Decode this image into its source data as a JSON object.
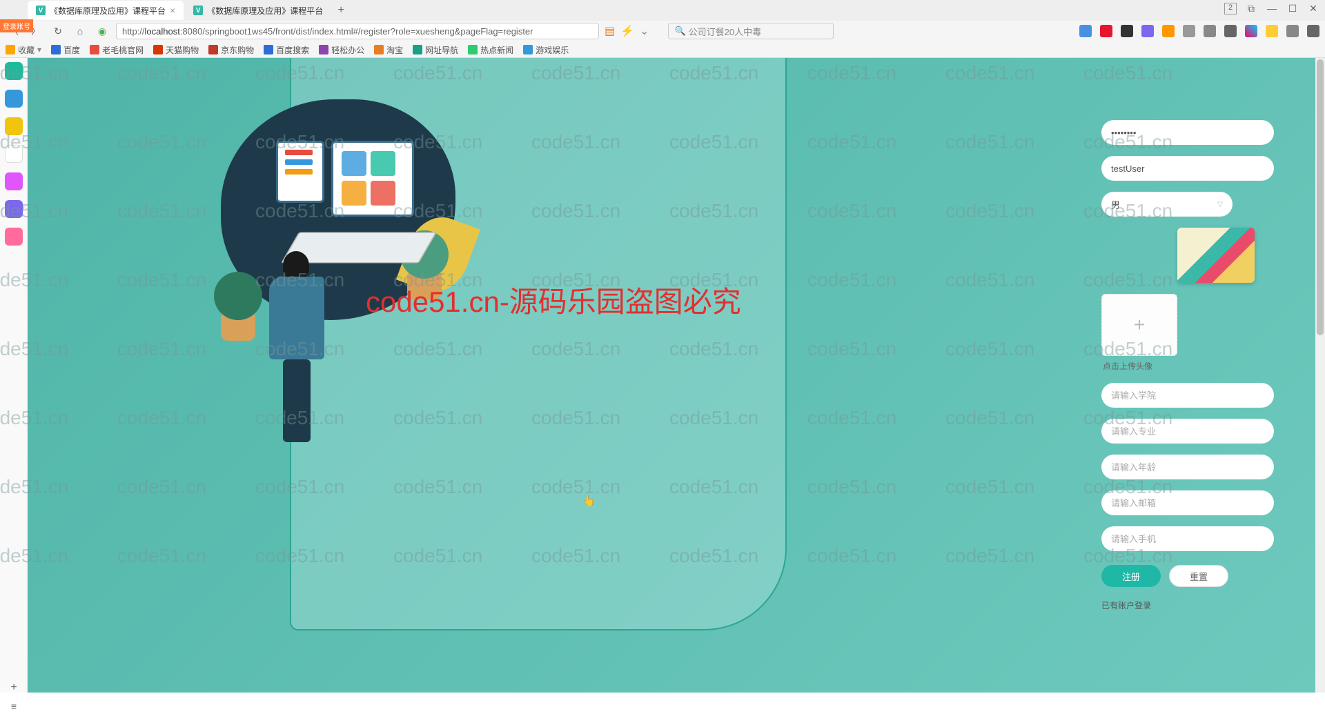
{
  "window": {
    "tabs": [
      {
        "title": "《数据库原理及应用》课程平台",
        "active": true
      },
      {
        "title": "《数据库原理及应用》课程平台",
        "active": false
      }
    ],
    "badge_number": "2",
    "url": "http://localhost:8080/springboot1ws45/front/dist/index.html#/register?role=xuesheng&pageFlag=register",
    "url_host": "localhost",
    "search_placeholder": "公司订餐20人中毒",
    "login_badge": "登录账号"
  },
  "bookmarks": [
    "收藏",
    "百度",
    "老毛桃官网",
    "天猫购物",
    "京东购物",
    "百度搜索",
    "轻松办公",
    "淘宝",
    "网址导航",
    "热点新闻",
    "游戏娱乐"
  ],
  "form": {
    "password_value": "........",
    "username_value": "testUser",
    "gender_value": "男",
    "upload_hint": "点击上传头像",
    "college_placeholder": "请输入学院",
    "major_placeholder": "请输入专业",
    "age_placeholder": "请输入年龄",
    "email_placeholder": "请输入邮箱",
    "phone_placeholder": "请输入手机",
    "submit_label": "注册",
    "reset_label": "重置",
    "login_link": "已有账户登录"
  },
  "watermark": {
    "text": "code51.cn",
    "red_text": "code51.cn-源码乐园盗图必究"
  }
}
